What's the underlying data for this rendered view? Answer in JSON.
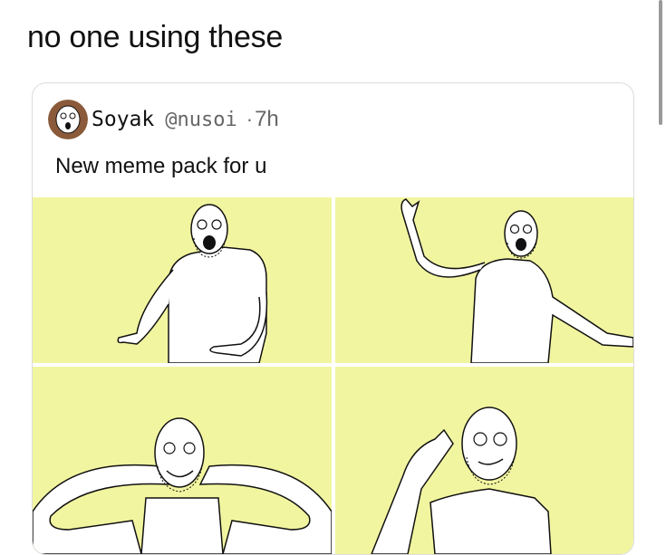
{
  "tweet": {
    "text": "no one using these"
  },
  "quoted_tweet": {
    "author_name": "Soyak",
    "author_handle": "@nusoi",
    "separator": "·",
    "time": "7h",
    "text": "New meme pack for u"
  },
  "colors": {
    "panel_background": "#f2f5a0",
    "text_primary": "#111111",
    "text_secondary": "#666666"
  }
}
